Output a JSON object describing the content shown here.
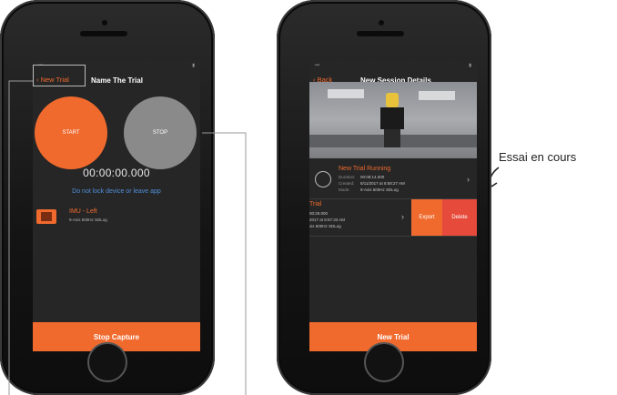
{
  "left_phone": {
    "nav_back": "New Trial",
    "nav_title": "Name The Trial",
    "start_label": "START",
    "stop_label": "STOP",
    "timer": "00:00:00.000",
    "warning": "Do not lock device or leave app",
    "sensor_name": "IMU - Left",
    "sensor_desc": "9-Axis 500Hz SDLog",
    "bottom_button": "Stop Capture"
  },
  "right_phone": {
    "nav_back": "Back",
    "nav_title": "New Session Details",
    "running_trial": {
      "title": "New Trial Running",
      "duration_label": "Duration:",
      "duration": "00:08:14.000",
      "created_label": "Created:",
      "created": "8/11/2017 at 8:58:27 AM",
      "mode_label": "Mode:",
      "mode": "9-Axis 500Hz SDLog"
    },
    "prev_trial": {
      "title": "Trial",
      "line1": "00:29.000",
      "line2": "2017 at 8:57:33 AM",
      "line3": "xis 500Hz SDLog"
    },
    "export_label": "Export",
    "delete_label": "Delete",
    "bottom_button": "New Trial"
  },
  "annotation": "Essai en cours",
  "colors": {
    "accent": "#f06a2e",
    "delete": "#e64a3b",
    "link": "#4f8fd8"
  }
}
